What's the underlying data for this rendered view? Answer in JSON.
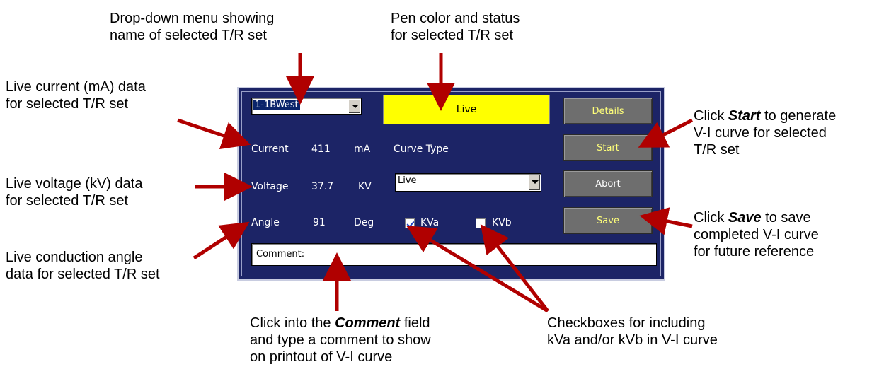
{
  "annotations": {
    "dropdown_menu": "Drop-down menu showing\nname of selected T/R set",
    "pen_color": "Pen color and status\nfor selected T/R set",
    "live_current": "Live current (mA) data\nfor selected T/R set",
    "live_voltage": "Live voltage (kV) data\nfor selected T/R set",
    "live_angle": "Live conduction angle\ndata for selected T/R set",
    "start": {
      "pre": "Click ",
      "bold": "Start",
      "post": " to generate\nV-I curve for selected\nT/R set"
    },
    "save": {
      "pre": "Click ",
      "bold": "Save",
      "post": " to save\ncompleted V-I curve\nfor future reference"
    },
    "comment": {
      "pre": "Click into the ",
      "bold": "Comment",
      "post": " field\nand type a comment to show\non printout of V-I curve"
    },
    "checkboxes": "Checkboxes for including\nkVa and/or kVb in V-I curve"
  },
  "panel": {
    "tr_set": "1-1BWest",
    "status": "Live",
    "status_color": "#ffff00",
    "buttons": {
      "details": "Details",
      "start": "Start",
      "abort": "Abort",
      "save": "Save"
    },
    "current": {
      "label": "Current",
      "value": "411",
      "unit": "mA"
    },
    "voltage": {
      "label": "Voltage",
      "value": "37.7",
      "unit": "KV"
    },
    "angle": {
      "label": "Angle",
      "value": "91",
      "unit": "Deg"
    },
    "curve_type_label": "Curve Type",
    "curve_type_value": "Live",
    "kva": {
      "label": "KVa",
      "checked": true
    },
    "kvb": {
      "label": "KVb",
      "checked": false
    },
    "comment_value": "Comment:"
  },
  "colors": {
    "arrow": "#b00000",
    "panel_bg": "#1c2466",
    "button_text": "#ffff7a"
  }
}
